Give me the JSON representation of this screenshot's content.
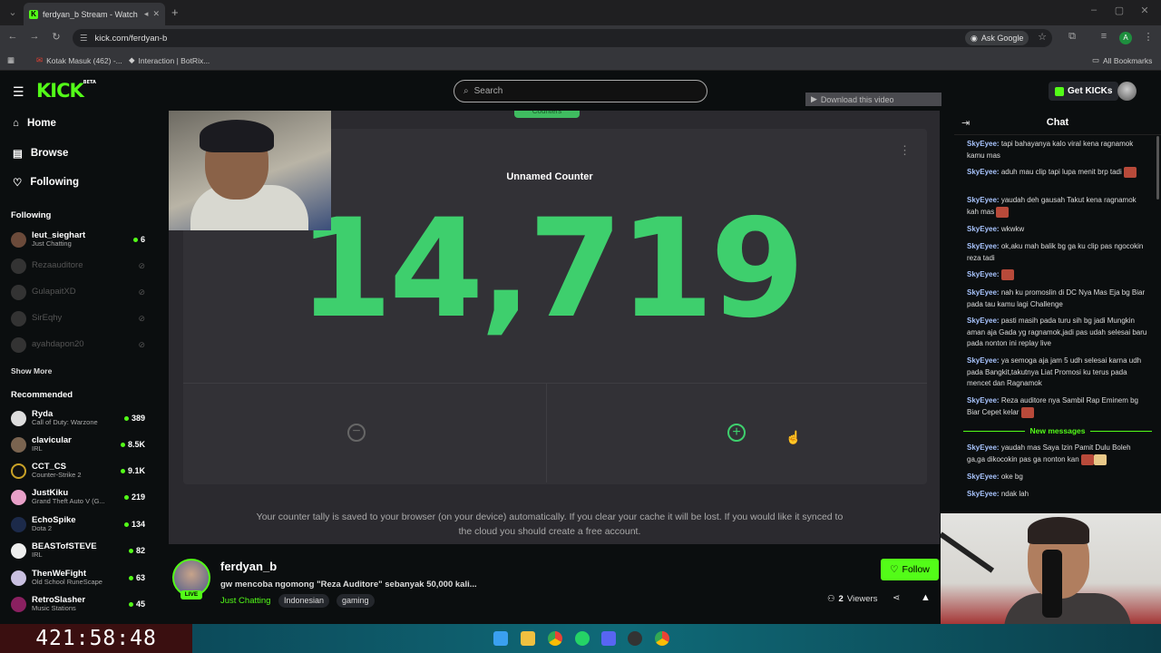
{
  "browser": {
    "tab_title": "ferdyan_b Stream - Watch",
    "url": "kick.com/ferdyan-b",
    "ask_google": "Ask Google",
    "profile_letter": "A",
    "bookmarks": [
      "Kotak Masuk (462) -...",
      "Interaction | BotRix..."
    ],
    "all_bookmarks": "All Bookmarks"
  },
  "header": {
    "logo": "KICK",
    "logo_badge": "BETA",
    "search_placeholder": "Search",
    "get_kicks": "Get KICKs"
  },
  "sidebar": {
    "nav": [
      {
        "label": "Home",
        "icon": "home-icon"
      },
      {
        "label": "Browse",
        "icon": "browse-icon"
      },
      {
        "label": "Following",
        "icon": "heart-icon"
      }
    ],
    "following_title": "Following",
    "following": [
      {
        "name": "leut_sieghart",
        "game": "Just Chatting",
        "viewers": "6",
        "live": true
      },
      {
        "name": "Rezaauditore",
        "live": false
      },
      {
        "name": "GulapaitXD",
        "live": false
      },
      {
        "name": "SirEqhy",
        "live": false
      },
      {
        "name": "ayahdapon20",
        "live": false
      }
    ],
    "show_more": "Show More",
    "recommended_title": "Recommended",
    "recommended": [
      {
        "name": "Ryda",
        "game": "Call of Duty: Warzone",
        "viewers": "389"
      },
      {
        "name": "clavicular",
        "game": "IRL",
        "viewers": "8.5K"
      },
      {
        "name": "CCT_CS",
        "game": "Counter-Strike 2",
        "viewers": "9.1K"
      },
      {
        "name": "JustKiku",
        "game": "Grand Theft Auto V (G...",
        "viewers": "219"
      },
      {
        "name": "EchoSpike",
        "game": "Dota 2",
        "viewers": "134"
      },
      {
        "name": "BEASTofSTEVE",
        "game": "IRL",
        "viewers": "82"
      },
      {
        "name": "ThenWeFight",
        "game": "Old School RuneScape",
        "viewers": "63"
      },
      {
        "name": "RetroSlasher",
        "game": "Music Stations",
        "viewers": "45"
      }
    ]
  },
  "timer": "421:58:48",
  "video": {
    "counter_tab": "Counters",
    "download_bar": "Download this video",
    "counter_name": "Unnamed Counter",
    "counter_value": "14,719",
    "note": "Your counter tally is saved to your browser (on your device) automatically. If you clear your cache it will be lost. If you would like it synced to the cloud you should create a free account."
  },
  "stream": {
    "live_badge": "LIVE",
    "streamer": "ferdyan_b",
    "title": "gw mencoba ngomong \"Reza Auditore\" sebanyak 50,000 kali...",
    "category": "Just Chatting",
    "tags": [
      "Indonesian",
      "gaming"
    ],
    "follow": "Follow",
    "viewers_count": "2",
    "viewers_label": "Viewers"
  },
  "chat": {
    "title": "Chat",
    "messages_before": [
      {
        "user": "SkyEyee",
        "text": "tapi bahayanya kalo viral kena ragnamok kamu mas",
        "emotes": 0
      },
      {
        "user": "SkyEyee",
        "text": "aduh mau clip tapi lupa menit brp tadi",
        "emotes": 1
      },
      {
        "user": "SkyEyee",
        "text": "yaudah deh gausah Takut kena ragnamok kah mas",
        "emotes": 1
      },
      {
        "user": "SkyEyee",
        "text": "wkwkw",
        "emotes": 0
      },
      {
        "user": "SkyEyee",
        "text": "ok,aku mah balik bg ga ku clip pas ngocokin reza tadi",
        "emotes": 0
      },
      {
        "user": "SkyEyee",
        "text": "",
        "emotes": 1
      },
      {
        "user": "SkyEyee",
        "text": "nah ku promoslin di DC Nya Mas Eja bg Biar pada tau kamu lagi Challenge",
        "emotes": 0
      },
      {
        "user": "SkyEyee",
        "text": "pasti masih pada turu sih bg jadi Mungkin aman aja Gada yg ragnamok,jadi pas udah selesai baru pada nonton ini replay live",
        "emotes": 0
      },
      {
        "user": "SkyEyee",
        "text": "ya semoga aja jam 5 udh selesai karna udh pada Bangkit,takutnya Liat Promosi ku terus pada mencet dan Ragnamok",
        "emotes": 0
      },
      {
        "user": "SkyEyee",
        "text": "Reza auditore nya Sambil Rap Eminem bg Biar Cepet kelar",
        "emotes": 1
      }
    ],
    "new_messages_label": "New messages",
    "messages_after": [
      {
        "user": "SkyEyee",
        "text": "yaudah mas Saya Izin Pamit Dulu Boleh ga,ga dikocokin pas ga nonton kan",
        "emotes": 2
      },
      {
        "user": "SkyEyee",
        "text": "oke bg",
        "emotes": 0
      },
      {
        "user": "SkyEyee",
        "text": "ndak lah",
        "emotes": 0
      }
    ]
  },
  "colors": {
    "accent": "#53fc18",
    "counter": "#3ecf6d",
    "username": "#a8c4ff"
  }
}
